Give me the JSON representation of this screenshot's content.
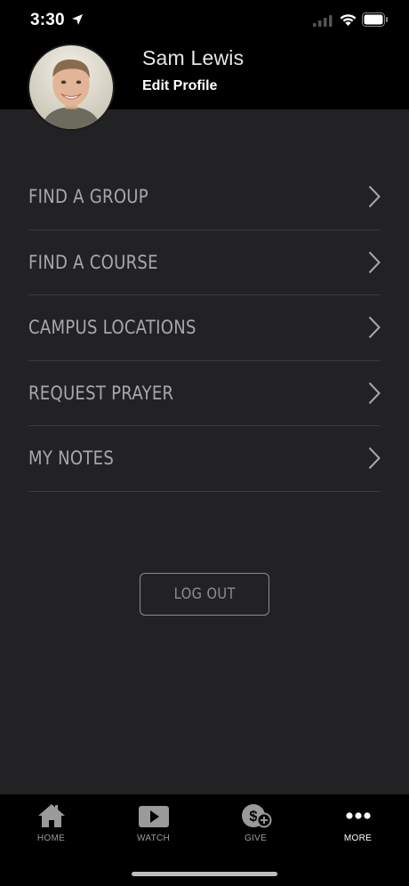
{
  "status_bar": {
    "time": "3:30"
  },
  "profile": {
    "name": "Sam Lewis",
    "edit_label": "Edit Profile"
  },
  "menu": {
    "items": [
      {
        "label": "FIND A GROUP"
      },
      {
        "label": "FIND A COURSE"
      },
      {
        "label": "CAMPUS LOCATIONS"
      },
      {
        "label": "REQUEST PRAYER"
      },
      {
        "label": "MY NOTES"
      }
    ]
  },
  "logout_label": "LOG OUT",
  "tabbar": {
    "tabs": [
      {
        "label": "HOME",
        "icon": "home-icon"
      },
      {
        "label": "WATCH",
        "icon": "play-icon"
      },
      {
        "label": "GIVE",
        "icon": "give-icon"
      },
      {
        "label": "MORE",
        "icon": "more-icon"
      }
    ],
    "active_tab": "MORE"
  },
  "colors": {
    "background": "#222224",
    "header": "#000000",
    "menu_text": "#a8a8aa",
    "divider": "#3a3a3c"
  }
}
